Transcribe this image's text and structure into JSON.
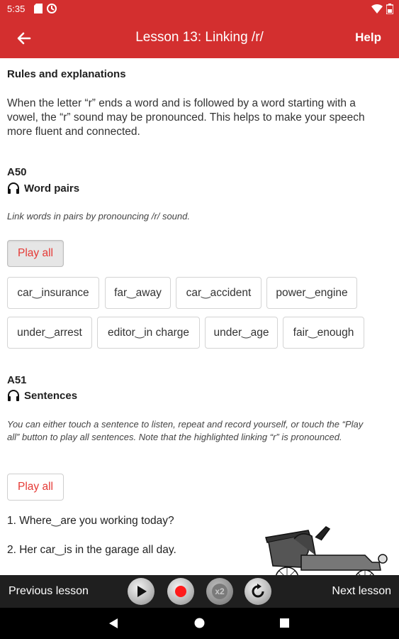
{
  "status_bar": {
    "time": "5:35"
  },
  "app_bar": {
    "title": "Lesson 13: Linking /r/",
    "help_label": "Help"
  },
  "rules": {
    "heading": "Rules and explanations",
    "text": "When the letter “r” ends a word and is followed by a word starting with a vowel, the “r” sound may be pronounced. This helps to make your speech more fluent and connected."
  },
  "exercise_a50": {
    "code": "A50",
    "title": "Word pairs",
    "icon": "headphones-icon",
    "instruction": "Link words in pairs by pronouncing /r/ sound.",
    "play_all_label": "Play all",
    "pairs": [
      "car‿insurance",
      "far‿away",
      "car‿accident",
      "power‿engine",
      "under‿arrest",
      "editor‿in charge",
      "under‿age",
      "fair‿enough"
    ]
  },
  "exercise_a51": {
    "code": "A51",
    "title": "Sentences",
    "icon": "headphones-icon",
    "instruction": "You can either touch a sentence to listen, repeat and record yourself, or touch the “Play all” button to play all sentences. Note that the highlighted linking “r” is pronounced.",
    "play_all_label": "Play all",
    "sentences": [
      "1. Where‿are you working today?",
      "2. Her car‿is in the garage all day."
    ]
  },
  "player_bar": {
    "prev_label": "Previous lesson",
    "next_label": "Next lesson",
    "speed_label": "x2",
    "controls": [
      "play-icon",
      "record-icon",
      "speed-icon",
      "replay-icon"
    ]
  },
  "colors": {
    "accent": "#d32f2f",
    "record": "#ff1a1a",
    "player_bg": "#1f1f1f"
  }
}
